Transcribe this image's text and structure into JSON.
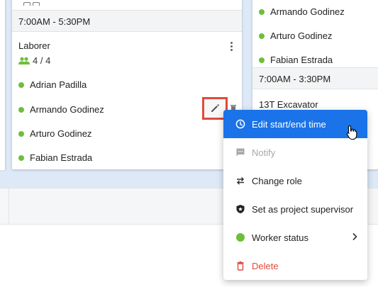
{
  "main_card": {
    "shift_time": "7:00AM - 5:30PM",
    "role": "Laborer",
    "count": "4 / 4",
    "workers": [
      {
        "name": "Adrian Padilla",
        "status_color": "#6dbf3a"
      },
      {
        "name": "Armando Godinez",
        "status_color": "#6dbf3a"
      },
      {
        "name": "Arturo Godinez",
        "status_color": "#6dbf3a"
      },
      {
        "name": "Fabian Estrada",
        "status_color": "#6dbf3a"
      }
    ],
    "icons": {
      "count": "people-icon",
      "more": "more-vertical-icon",
      "edit": "pencil-icon"
    }
  },
  "right_card": {
    "workers": [
      {
        "name": "Armando Godinez",
        "status_color": "#6dbf3a"
      },
      {
        "name": "Arturo Godinez",
        "status_color": "#6dbf3a"
      },
      {
        "name": "Fabian Estrada",
        "status_color": "#6dbf3a"
      }
    ],
    "shift_time": "7:00AM - 3:30PM",
    "role": "13T Excavator"
  },
  "context_menu": {
    "items": [
      {
        "label": "Edit start/end time",
        "icon": "clock-icon",
        "state": "highlighted"
      },
      {
        "label": "Notify",
        "icon": "message-icon",
        "state": "disabled"
      },
      {
        "label": "Change role",
        "icon": "swap-icon",
        "state": "normal"
      },
      {
        "label": "Set as project supervisor",
        "icon": "shield-icon",
        "state": "normal"
      },
      {
        "label": "Worker status",
        "icon": "status-dot-icon",
        "state": "submenu"
      },
      {
        "label": "Delete",
        "icon": "trash-icon",
        "state": "danger"
      }
    ]
  },
  "colors": {
    "accent": "#1a73e8",
    "status_green": "#6dbf3a",
    "danger": "#e14b3b",
    "highlight_box": "#e04a3a",
    "board_background": "#dde9f7"
  }
}
